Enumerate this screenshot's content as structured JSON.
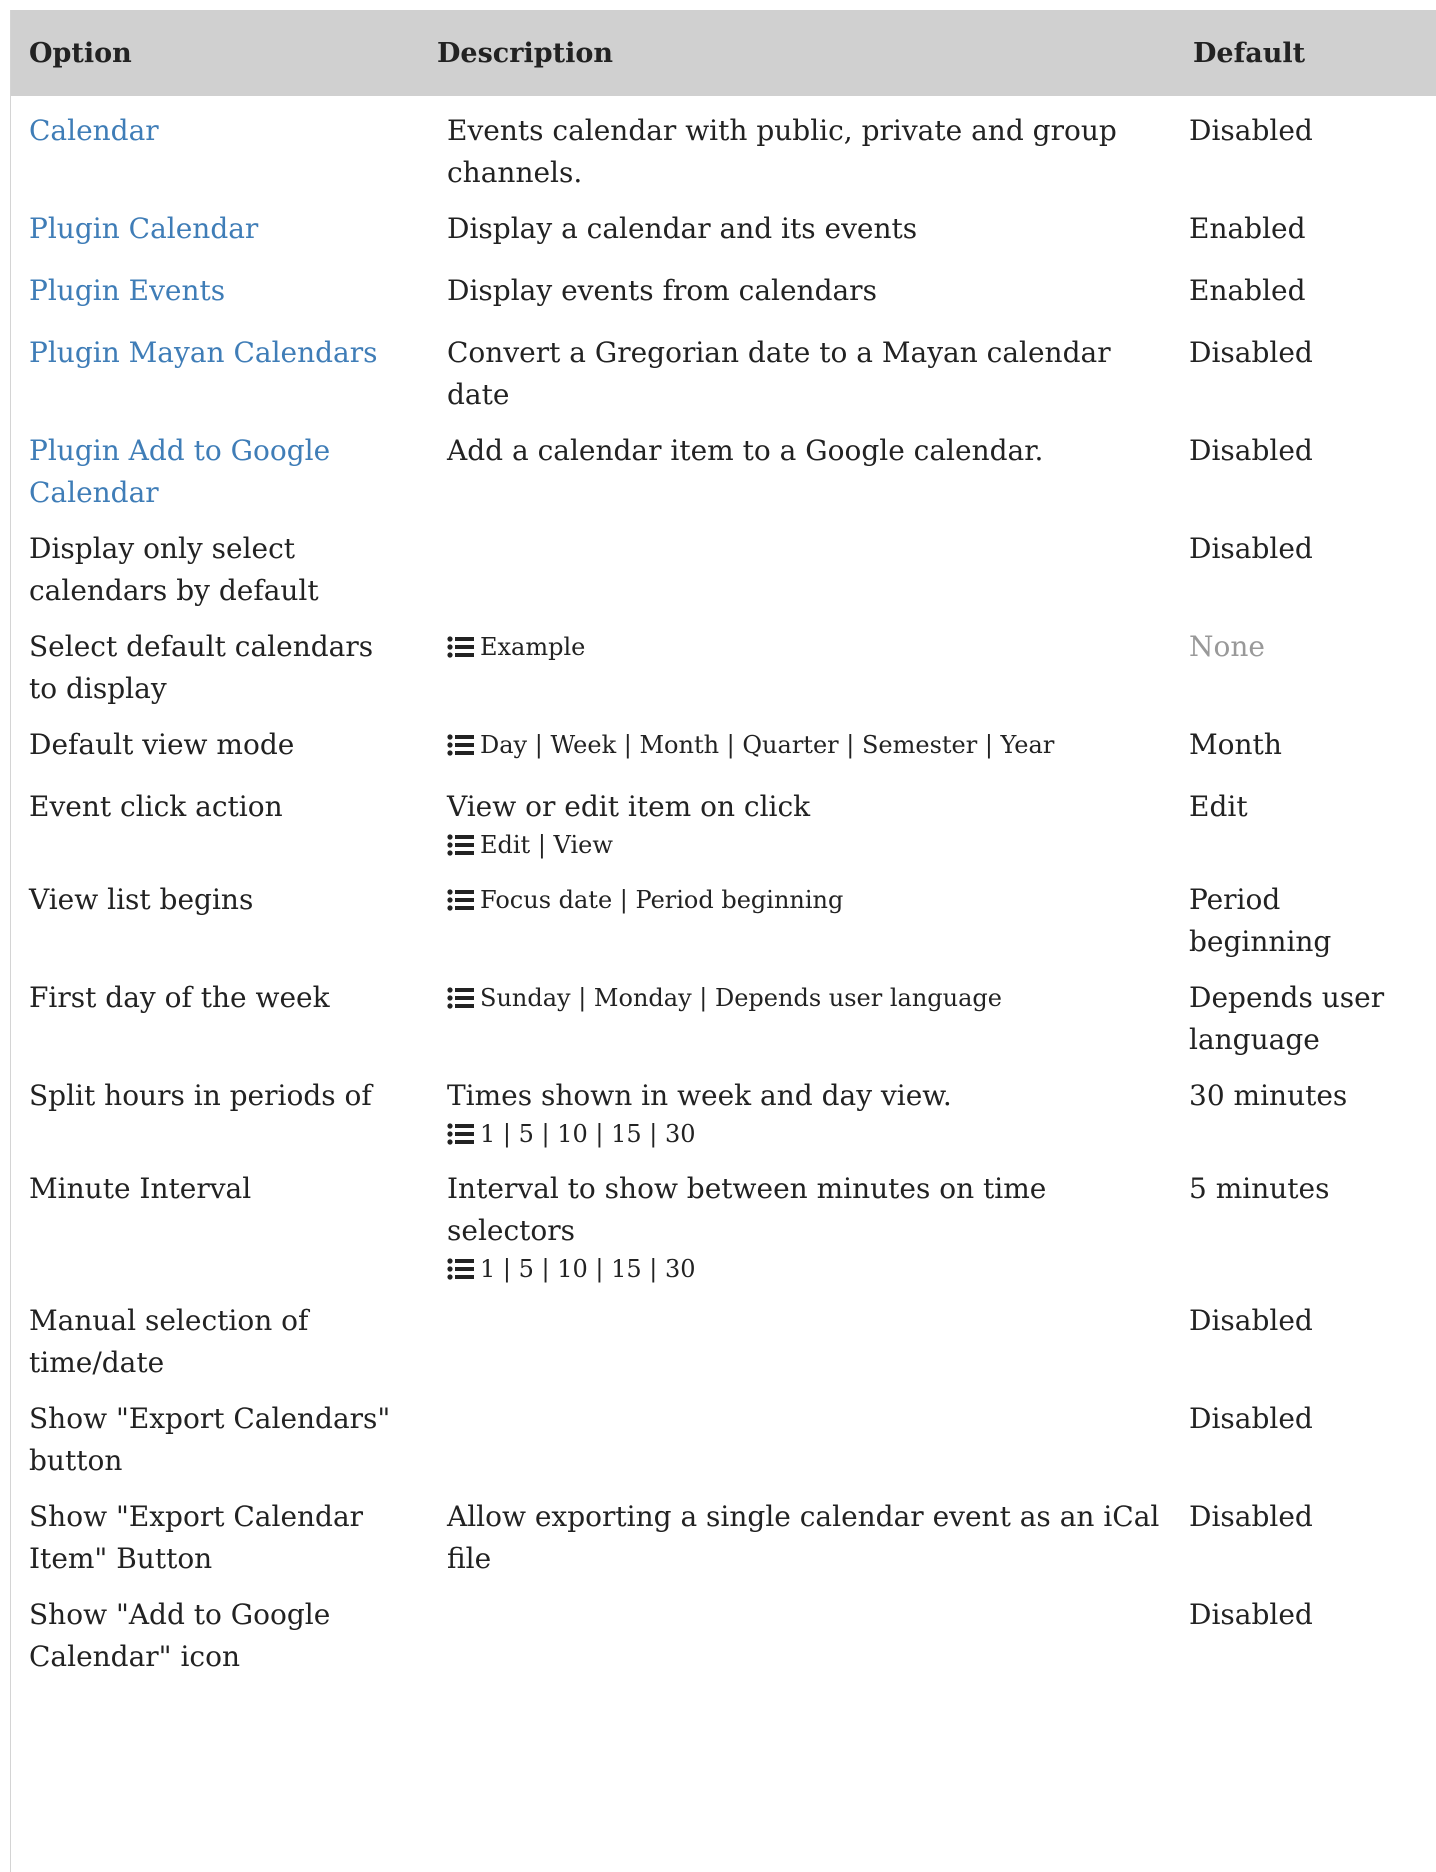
{
  "table": {
    "headers": {
      "option": "Option",
      "description": "Description",
      "default": "Default"
    },
    "rows": [
      {
        "option": "Calendar",
        "link": true,
        "description": "Events calendar with public, private and group channels.",
        "options": "",
        "default": "Disabled"
      },
      {
        "option": "Plugin Calendar",
        "link": true,
        "description": "Display a calendar and its events",
        "options": "",
        "default": "Enabled"
      },
      {
        "option": "Plugin Events",
        "link": true,
        "description": "Display events from calendars",
        "options": "",
        "default": "Enabled"
      },
      {
        "option": "Plugin Mayan Calendars",
        "link": true,
        "description": "Convert a Gregorian date to a Mayan calendar date",
        "options": "",
        "default": "Disabled"
      },
      {
        "option": "Plugin Add to Google Calendar",
        "link": true,
        "description": "Add a calendar item to a Google calendar.",
        "options": "",
        "default": "Disabled"
      },
      {
        "option": "Display only select calendars by default",
        "link": false,
        "description": "",
        "options": "",
        "default": "Disabled"
      },
      {
        "option": "Select default calendars to display",
        "link": false,
        "description": "",
        "options": "Example",
        "default": "None",
        "default_muted": true
      },
      {
        "option": "Default view mode",
        "link": false,
        "description": "",
        "options": "Day | Week | Month | Quarter | Semester | Year",
        "default": "Month"
      },
      {
        "option": "Event click action",
        "link": false,
        "description": "View or edit item on click",
        "options": "Edit | View",
        "default": "Edit"
      },
      {
        "option": "View list begins",
        "link": false,
        "description": "",
        "options": "Focus date | Period beginning",
        "default": "Period beginning"
      },
      {
        "option": "First day of the week",
        "link": false,
        "description": "",
        "options": "Sunday | Monday | Depends user language",
        "default": "Depends user language"
      },
      {
        "option": "Split hours in periods of",
        "link": false,
        "description": "Times shown in week and day view.",
        "options": "1 | 5 | 10 | 15 | 30",
        "default": "30 minutes"
      },
      {
        "option": "Minute Interval",
        "link": false,
        "description": "Interval to show between minutes on time selectors",
        "options": "1 | 5 | 10 | 15 | 30",
        "default": "5 minutes"
      },
      {
        "option": "Manual selection of time/date",
        "link": false,
        "description": "",
        "options": "",
        "default": "Disabled"
      },
      {
        "option": "Show \"Export Calendars\" button",
        "link": false,
        "description": "",
        "options": "",
        "default": "Disabled"
      },
      {
        "option": "Show \"Export Calendar Item\" Button",
        "link": false,
        "description": "Allow exporting a single calendar event as an iCal file",
        "options": "",
        "default": "Disabled"
      },
      {
        "option": "Show \"Add to Google Calendar\" icon",
        "link": false,
        "description": "",
        "options": "",
        "default": "Disabled"
      }
    ]
  },
  "colors": {
    "link": "#3f7db7",
    "header_bg": "#d0d0d0",
    "muted": "#999999"
  },
  "icons": {
    "options_list": "list-icon"
  }
}
